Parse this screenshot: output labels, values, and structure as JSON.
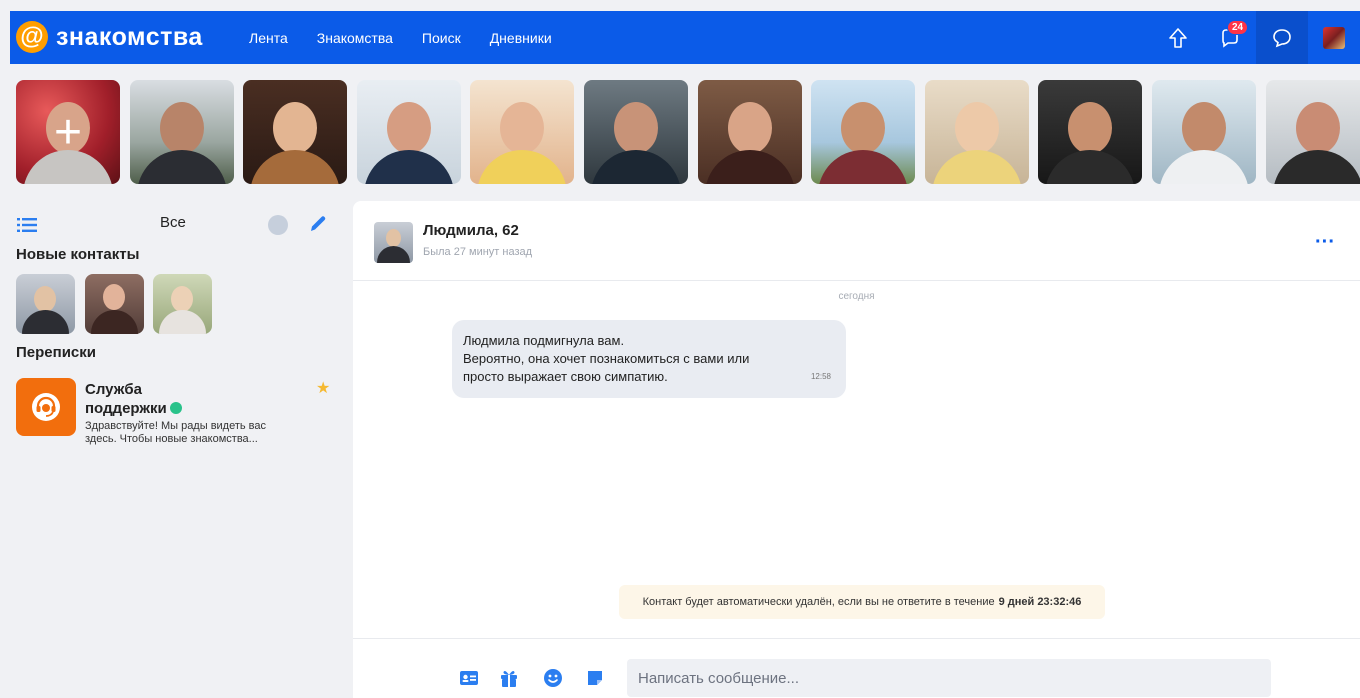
{
  "header": {
    "logo_symbol": "@",
    "logo_text": "знакомства",
    "nav": [
      "Лента",
      "Знакомства",
      "Поиск",
      "Дневники"
    ],
    "notifications_count": "24",
    "icons": [
      "upload-arrow-icon",
      "notifications-icon",
      "chat-bubble-icon",
      "user-avatar"
    ]
  },
  "stories": {
    "add_symbol": "+",
    "count": 12
  },
  "sidebar": {
    "filter_label": "Все",
    "new_contacts_heading": "Новые контакты",
    "chats_heading": "Переписки",
    "chats": [
      {
        "name": "Служба поддержки",
        "preview": "Здравствуйте! Мы рады видеть вас здесь. Чтобы новые знакомства...",
        "online": true,
        "starred": true
      }
    ]
  },
  "conversation": {
    "contact_name": "Людмила, 62",
    "contact_status": "Была 27 минут назад",
    "date_separator": "сегодня",
    "messages": [
      {
        "lines": [
          "Людмила подмигнула вам.",
          "Вероятно, она хочет познакомиться с вами или",
          "просто выражает свою симпатию."
        ],
        "time": "12:58"
      }
    ],
    "warning_text": "Контакт будет автоматически удалён, если вы не ответите в течение",
    "warning_timer": "9 дней 23:32:46",
    "input_placeholder": "Написать сообщение..."
  },
  "colors": {
    "brand_blue": "#0b5be8",
    "logo_orange": "#ff9e00",
    "support_orange": "#f26e0d",
    "online_green": "#29c28a",
    "badge_red": "#ff3347"
  }
}
